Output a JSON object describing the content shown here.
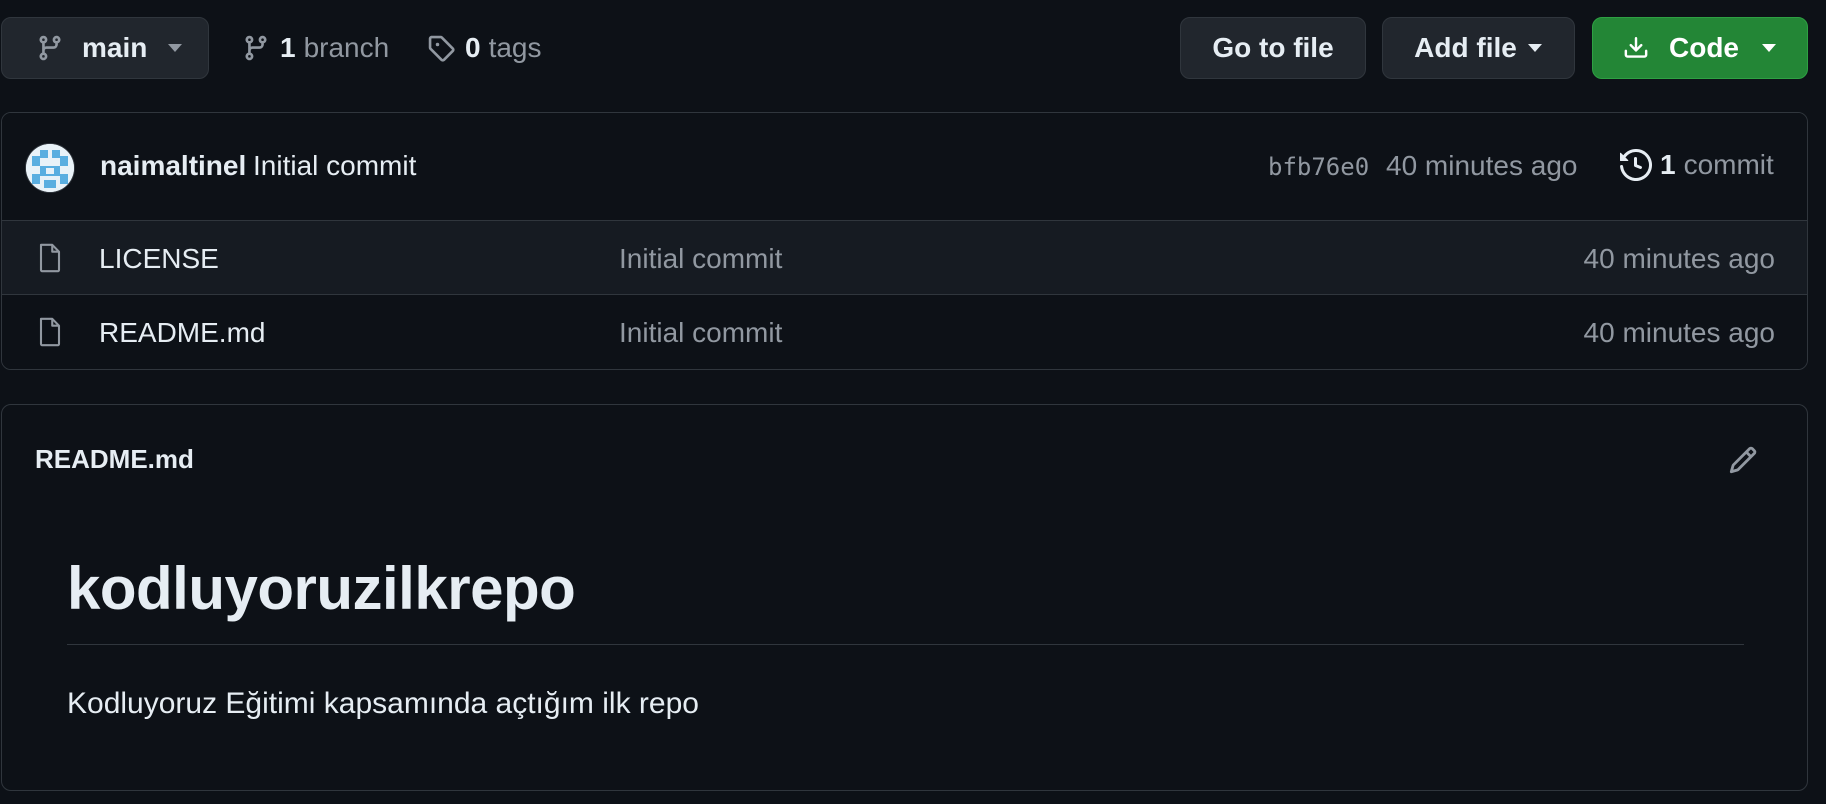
{
  "toolbar": {
    "branch": "main",
    "branch_count": "1",
    "branch_label": "branch",
    "tag_count": "0",
    "tag_label": "tags",
    "go_to_file": "Go to file",
    "add_file": "Add file",
    "code": "Code"
  },
  "commit": {
    "author": "naimaltinel",
    "message": "Initial commit",
    "sha": "bfb76e0",
    "time": "40 minutes ago",
    "count": "1",
    "count_label": "commit"
  },
  "files": [
    {
      "name": "LICENSE",
      "message": "Initial commit",
      "time": "40 minutes ago",
      "icon": "file-icon"
    },
    {
      "name": "README.md",
      "message": "Initial commit",
      "time": "40 minutes ago",
      "icon": "file-icon"
    }
  ],
  "readme": {
    "filename": "README.md",
    "heading": "kodluyoruzilkrepo",
    "paragraph": "Kodluyoruz Eğitimi kapsamında açtığım ilk repo"
  },
  "colors": {
    "background": "#0d1117",
    "border": "#30363d",
    "button": "#21262d",
    "code_button": "#238636",
    "muted_text": "#9198a1",
    "text": "#e6edf3"
  }
}
